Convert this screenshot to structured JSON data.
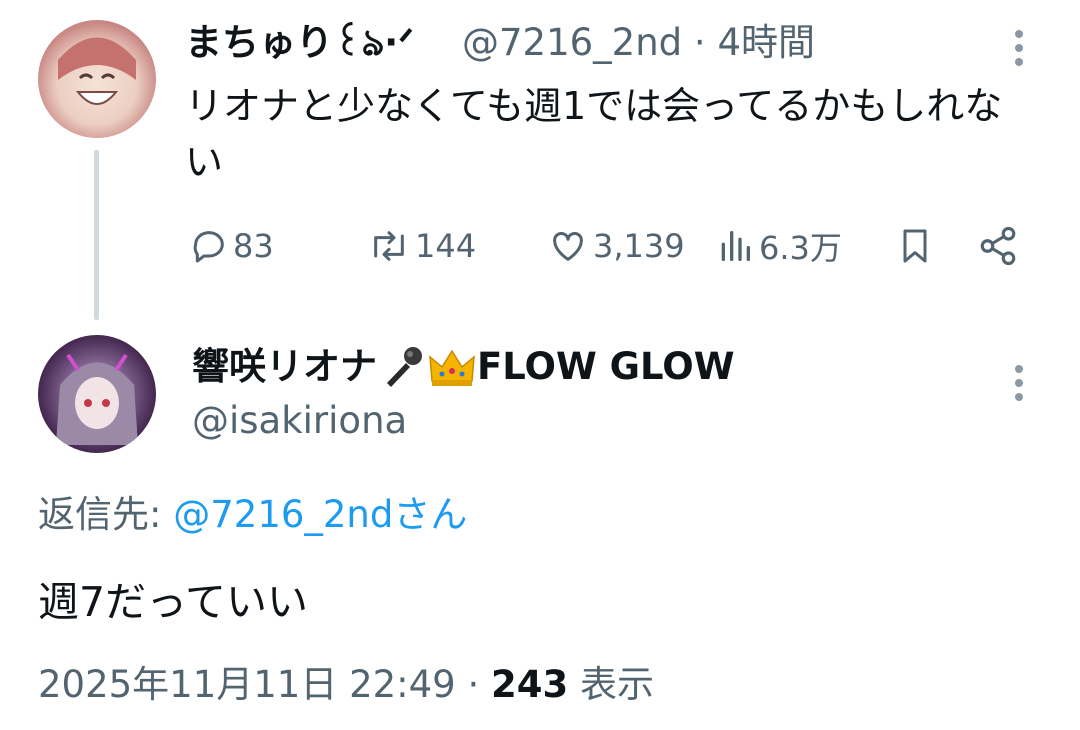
{
  "thread": {
    "parent": {
      "display_name": "まちゅり꒰ঌ·ᐟ",
      "handle": "@7216_2nd",
      "separator": "·",
      "time": "4時間",
      "text": "リオナと少なくても週1では会ってるかもしれない",
      "stats": {
        "replies": "83",
        "reposts": "144",
        "likes": "3,139",
        "views": "6.3万"
      },
      "icons": [
        "reply-icon",
        "repost-icon",
        "like-icon",
        "views-icon",
        "bookmark-icon",
        "share-icon",
        "more-icon"
      ]
    },
    "reply": {
      "display_name": "響咲リオナ",
      "name_suffix": "FLOW GLOW",
      "handle": "@isakiriona",
      "reply_to_label": "返信先: ",
      "reply_to_handle": "@7216_2ndさん",
      "text": "週7だっていい",
      "timestamp": "2025年11月11日 22:49",
      "separator": "·",
      "view_count": "243",
      "view_label": "表示"
    }
  },
  "colors": {
    "text": "#0f1419",
    "secondary": "#536471",
    "link": "#1d9bf0",
    "thread_line": "#cfd9de"
  }
}
